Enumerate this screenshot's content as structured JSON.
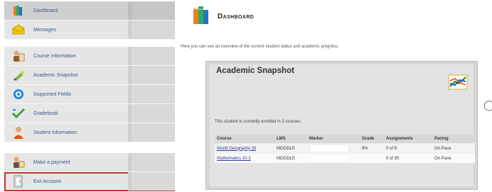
{
  "sidebar": {
    "items": [
      {
        "label": "Dashboard",
        "icon": "dashboard-book-icon"
      },
      {
        "label": "Messages",
        "icon": "messages-envelope-icon"
      },
      {
        "label": "Course Information",
        "icon": "course-information-icon"
      },
      {
        "label": "Academic Snapshot",
        "icon": "academic-snapshot-icon"
      },
      {
        "label": "Supported Fields",
        "icon": "supported-fields-icon"
      },
      {
        "label": "Gradebook",
        "icon": "gradebook-icon"
      },
      {
        "label": "Student Information",
        "icon": "student-information-icon"
      },
      {
        "label": "Make a payment",
        "icon": "payment-icon"
      },
      {
        "label": "Exit Account",
        "icon": "exit-door-icon"
      }
    ]
  },
  "header": {
    "title": "Dashboard"
  },
  "intro": "Here you can see an overview of the current student status and academic progress.",
  "panel": {
    "title": "Academic Snapshot",
    "enrolled_text": "This student is currently enrolled in 2 courses:",
    "columns": [
      "Course",
      "LMS",
      "Marker",
      "Grade",
      "Assignments",
      "Pacing"
    ],
    "rows": [
      {
        "course": "World Geography 30",
        "lms": "MOODLE",
        "marker": "",
        "grade": "8%",
        "assignments": "0 of 8",
        "pacing": "On Pace"
      },
      {
        "course": "Mathematics 10-3",
        "lms": "MOODLE",
        "marker": "",
        "grade": "",
        "assignments": "0 of 30",
        "pacing": "On Pace"
      }
    ]
  },
  "colors": {
    "accent_link": "#2a3d9a",
    "sidebar_text": "#3a5a8c",
    "highlight_box": "#c0392b"
  }
}
